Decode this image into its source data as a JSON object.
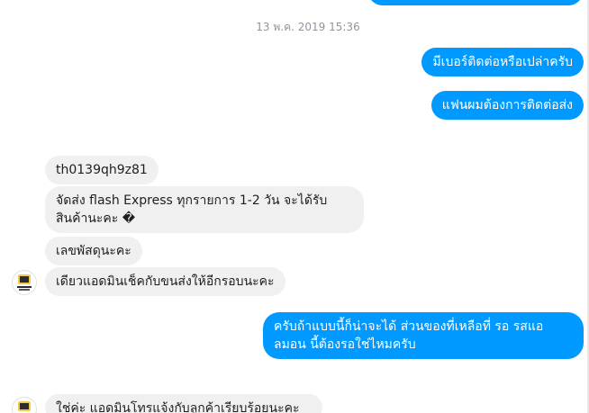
{
  "thread": {
    "timestamp": "13 พ.ค. 2019 15:36",
    "messages": [
      {
        "text": "มีเบอร์ติดต่อหรือเปล่าครับ"
      },
      {
        "text": "แฟนผมต้องการติดต่อส่ง"
      },
      {
        "text": "th0139qh9z81"
      },
      {
        "line1": "จัดส่ง flash Express ทุกรายการ 1-2 วัน จะได้รับ",
        "line2": "สินค้านะคะ �"
      },
      {
        "text": "เลขพัสดุนะคะ"
      },
      {
        "text": "เดียวแอดมินเช็คกับขนส่งให้อีกรอบนะคะ"
      },
      {
        "line1": "ครับถ้าแบบนี้ก็น่าจะได้  ส่วนของที่เหลือที่ รอ รสแอ",
        "line2": "ลมอน  นี้ต้องรอใช่ไหมครับ"
      },
      {
        "text": "ใช่ค่ะ แอดมินโทรแจ้งกับลูกค้าเรียบร้อยนะคะ"
      }
    ]
  },
  "colors": {
    "outgoing": "#0099ff",
    "incoming": "#f1f0f0",
    "timestamp": "#90949c"
  },
  "icons": {
    "avatar": "shop-logo-avatar"
  }
}
